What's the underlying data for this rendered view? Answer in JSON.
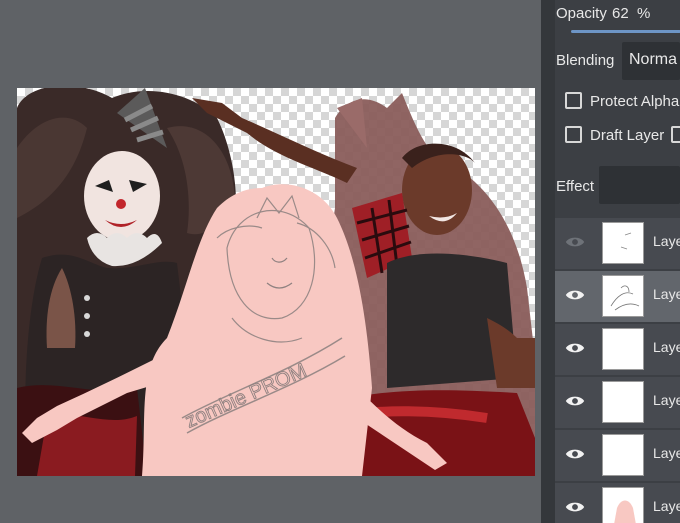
{
  "panel": {
    "opacity_label": "Opacity",
    "opacity_value": "62",
    "opacity_unit": "%",
    "opacity_percent": 62,
    "blending_label": "Blending",
    "blending_value": "Norma",
    "protect_alpha_label": "Protect Alpha",
    "protect_alpha_checked": false,
    "draft_layer_label": "Draft Layer",
    "draft_layer_checked": false,
    "effect_label": "Effect",
    "accent_color": "#6d95c6"
  },
  "layers": [
    {
      "name": "Laye",
      "visible": false,
      "selected": false,
      "eye_icon": "eye-icon"
    },
    {
      "name": "Laye",
      "visible": true,
      "selected": true,
      "eye_icon": "eye-icon"
    },
    {
      "name": "Laye",
      "visible": true,
      "selected": false,
      "eye_icon": "eye-icon"
    },
    {
      "name": "Laye",
      "visible": true,
      "selected": false,
      "eye_icon": "eye-icon"
    },
    {
      "name": "Laye",
      "visible": true,
      "selected": false,
      "eye_icon": "eye-icon"
    },
    {
      "name": "Laye",
      "visible": true,
      "selected": false,
      "eye_icon": "eye-icon"
    }
  ],
  "artwork": {
    "sash_text": "zombie PROM"
  }
}
